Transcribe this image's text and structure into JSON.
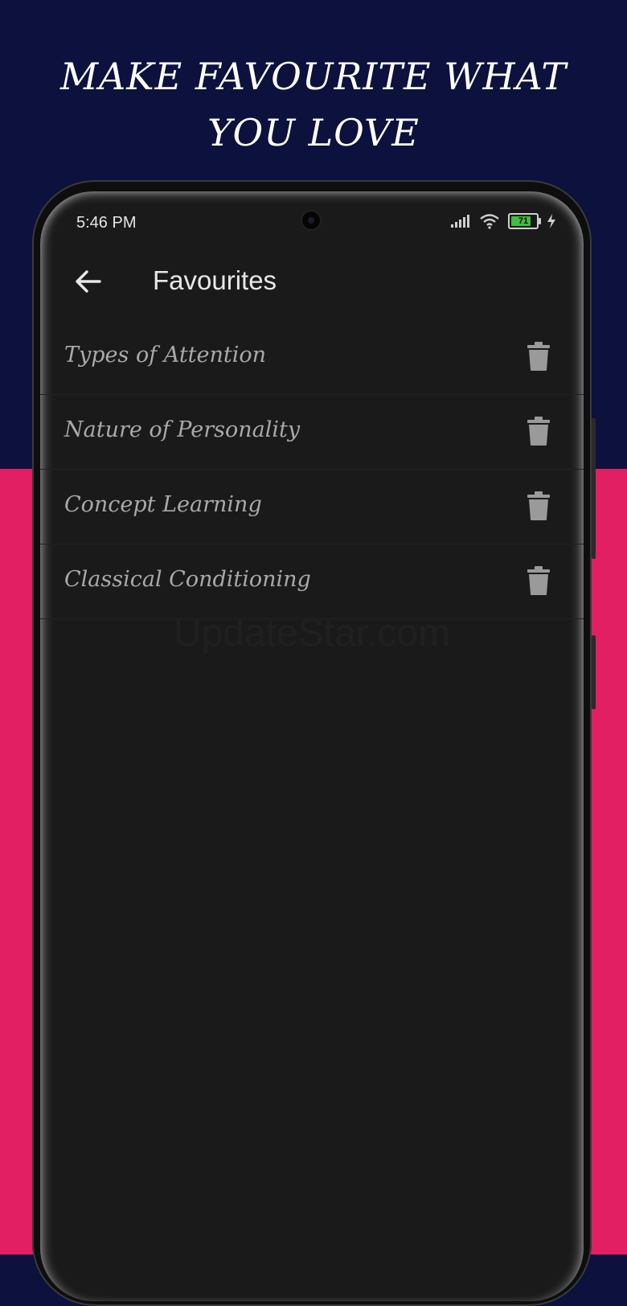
{
  "promo": {
    "headline_line1": "MAKE FAVOURITE WHAT",
    "headline_line2": "YOU LOVE"
  },
  "status_bar": {
    "time": "5:46 PM",
    "battery_level": "71",
    "battery_fraction": 0.71
  },
  "app_bar": {
    "title": "Favourites",
    "back_icon": "arrow-left-icon"
  },
  "favourites": [
    {
      "label": "Types of Attention",
      "action_icon": "trash-icon"
    },
    {
      "label": "Nature of Personality",
      "action_icon": "trash-icon"
    },
    {
      "label": "Concept Learning",
      "action_icon": "trash-icon"
    },
    {
      "label": "Classical Conditioning",
      "action_icon": "trash-icon"
    }
  ],
  "watermark": "UpdateStar.com",
  "colors": {
    "top_background": "#0d113d",
    "bottom_background": "#e31f63",
    "screen_background": "#1a1a1a",
    "item_text": "#a9a9a9"
  }
}
